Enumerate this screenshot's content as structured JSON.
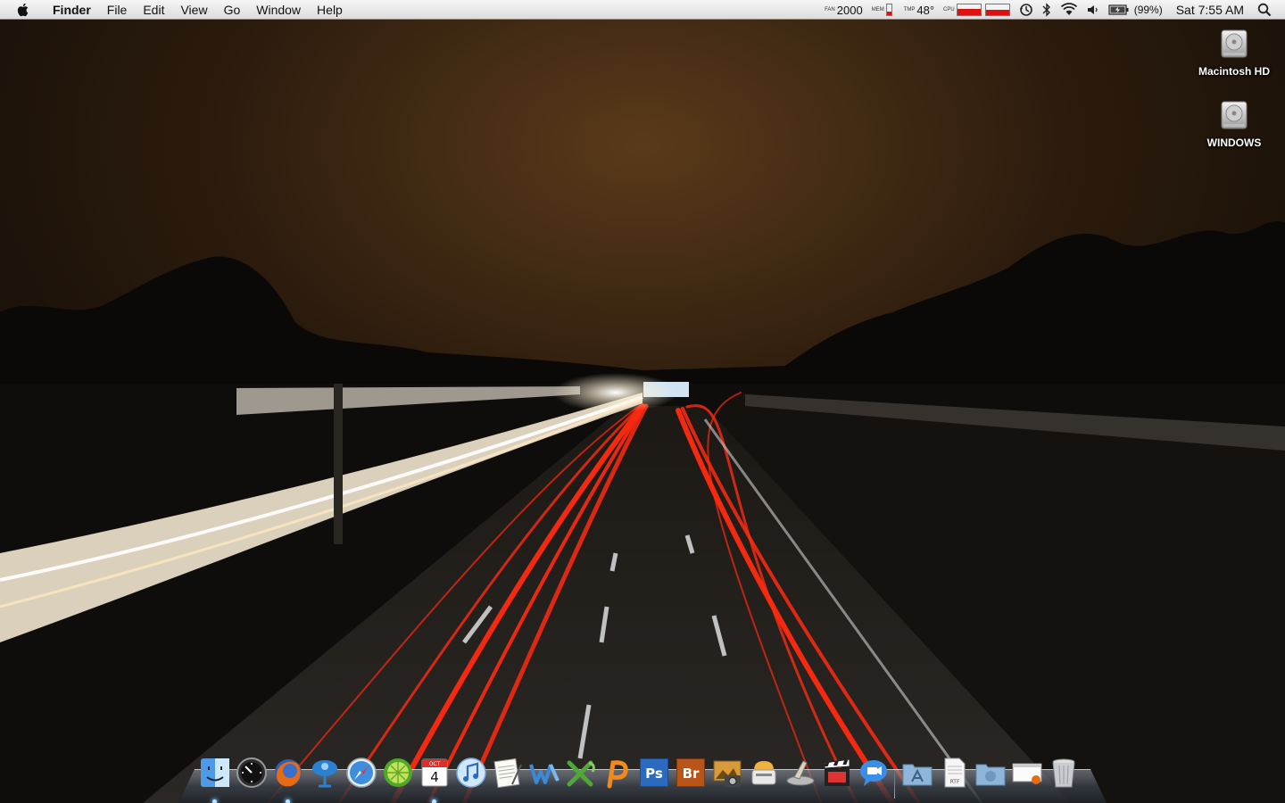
{
  "menubar": {
    "app_name": "Finder",
    "menus": [
      "File",
      "Edit",
      "View",
      "Go",
      "Window",
      "Help"
    ],
    "status": {
      "fan_label": "FAN",
      "fan_value": "2000",
      "mem_label": "MEM",
      "mem_level": 0.35,
      "temp_label": "TMP",
      "temp_value": "48°",
      "cpu_label": "CPU",
      "battery_percent": "(99%)",
      "clock": "Sat 7:55 AM"
    },
    "icons": [
      "apple-icon",
      "time-machine-icon",
      "bluetooth-icon",
      "wifi-icon",
      "volume-icon",
      "battery-icon",
      "spotlight-icon"
    ]
  },
  "desktop": {
    "icons": [
      {
        "label": "Macintosh HD",
        "icon": "hard-drive-icon"
      },
      {
        "label": "WINDOWS",
        "icon": "hard-drive-icon"
      }
    ]
  },
  "calendar_icon": {
    "month": "OCT",
    "day": "4"
  },
  "dock": {
    "apps": [
      {
        "name": "finder-icon",
        "running": true
      },
      {
        "name": "dashboard-icon",
        "running": false
      },
      {
        "name": "firefox-icon",
        "running": true
      },
      {
        "name": "chat-app-icon",
        "running": false
      },
      {
        "name": "safari-icon",
        "running": false
      },
      {
        "name": "limewire-icon",
        "running": false
      },
      {
        "name": "ical-icon",
        "running": true
      },
      {
        "name": "itunes-icon",
        "running": false
      },
      {
        "name": "textedit-icon",
        "running": false
      },
      {
        "name": "word-icon",
        "running": false
      },
      {
        "name": "excel-icon",
        "running": false
      },
      {
        "name": "powerpoint-icon",
        "running": false
      },
      {
        "name": "photoshop-icon",
        "running": false
      },
      {
        "name": "bridge-icon",
        "running": false
      },
      {
        "name": "iphoto-icon",
        "running": false
      },
      {
        "name": "toast-icon",
        "running": false
      },
      {
        "name": "syncing-icon",
        "running": false
      },
      {
        "name": "imovie-icon",
        "running": false
      },
      {
        "name": "ichat-icon",
        "running": false
      }
    ],
    "stacks": [
      "applications-stack-icon",
      "documents-stack-icon",
      "downloads-stack-icon",
      "file-icon",
      "trash-icon"
    ],
    "photoshop_label": "Ps",
    "bridge_label": "Br",
    "rtf_label": "RTF"
  },
  "colors": {
    "sky_top": "#3a2510",
    "trail_red": "#ff2a10",
    "trail_white": "#fff6e6"
  }
}
